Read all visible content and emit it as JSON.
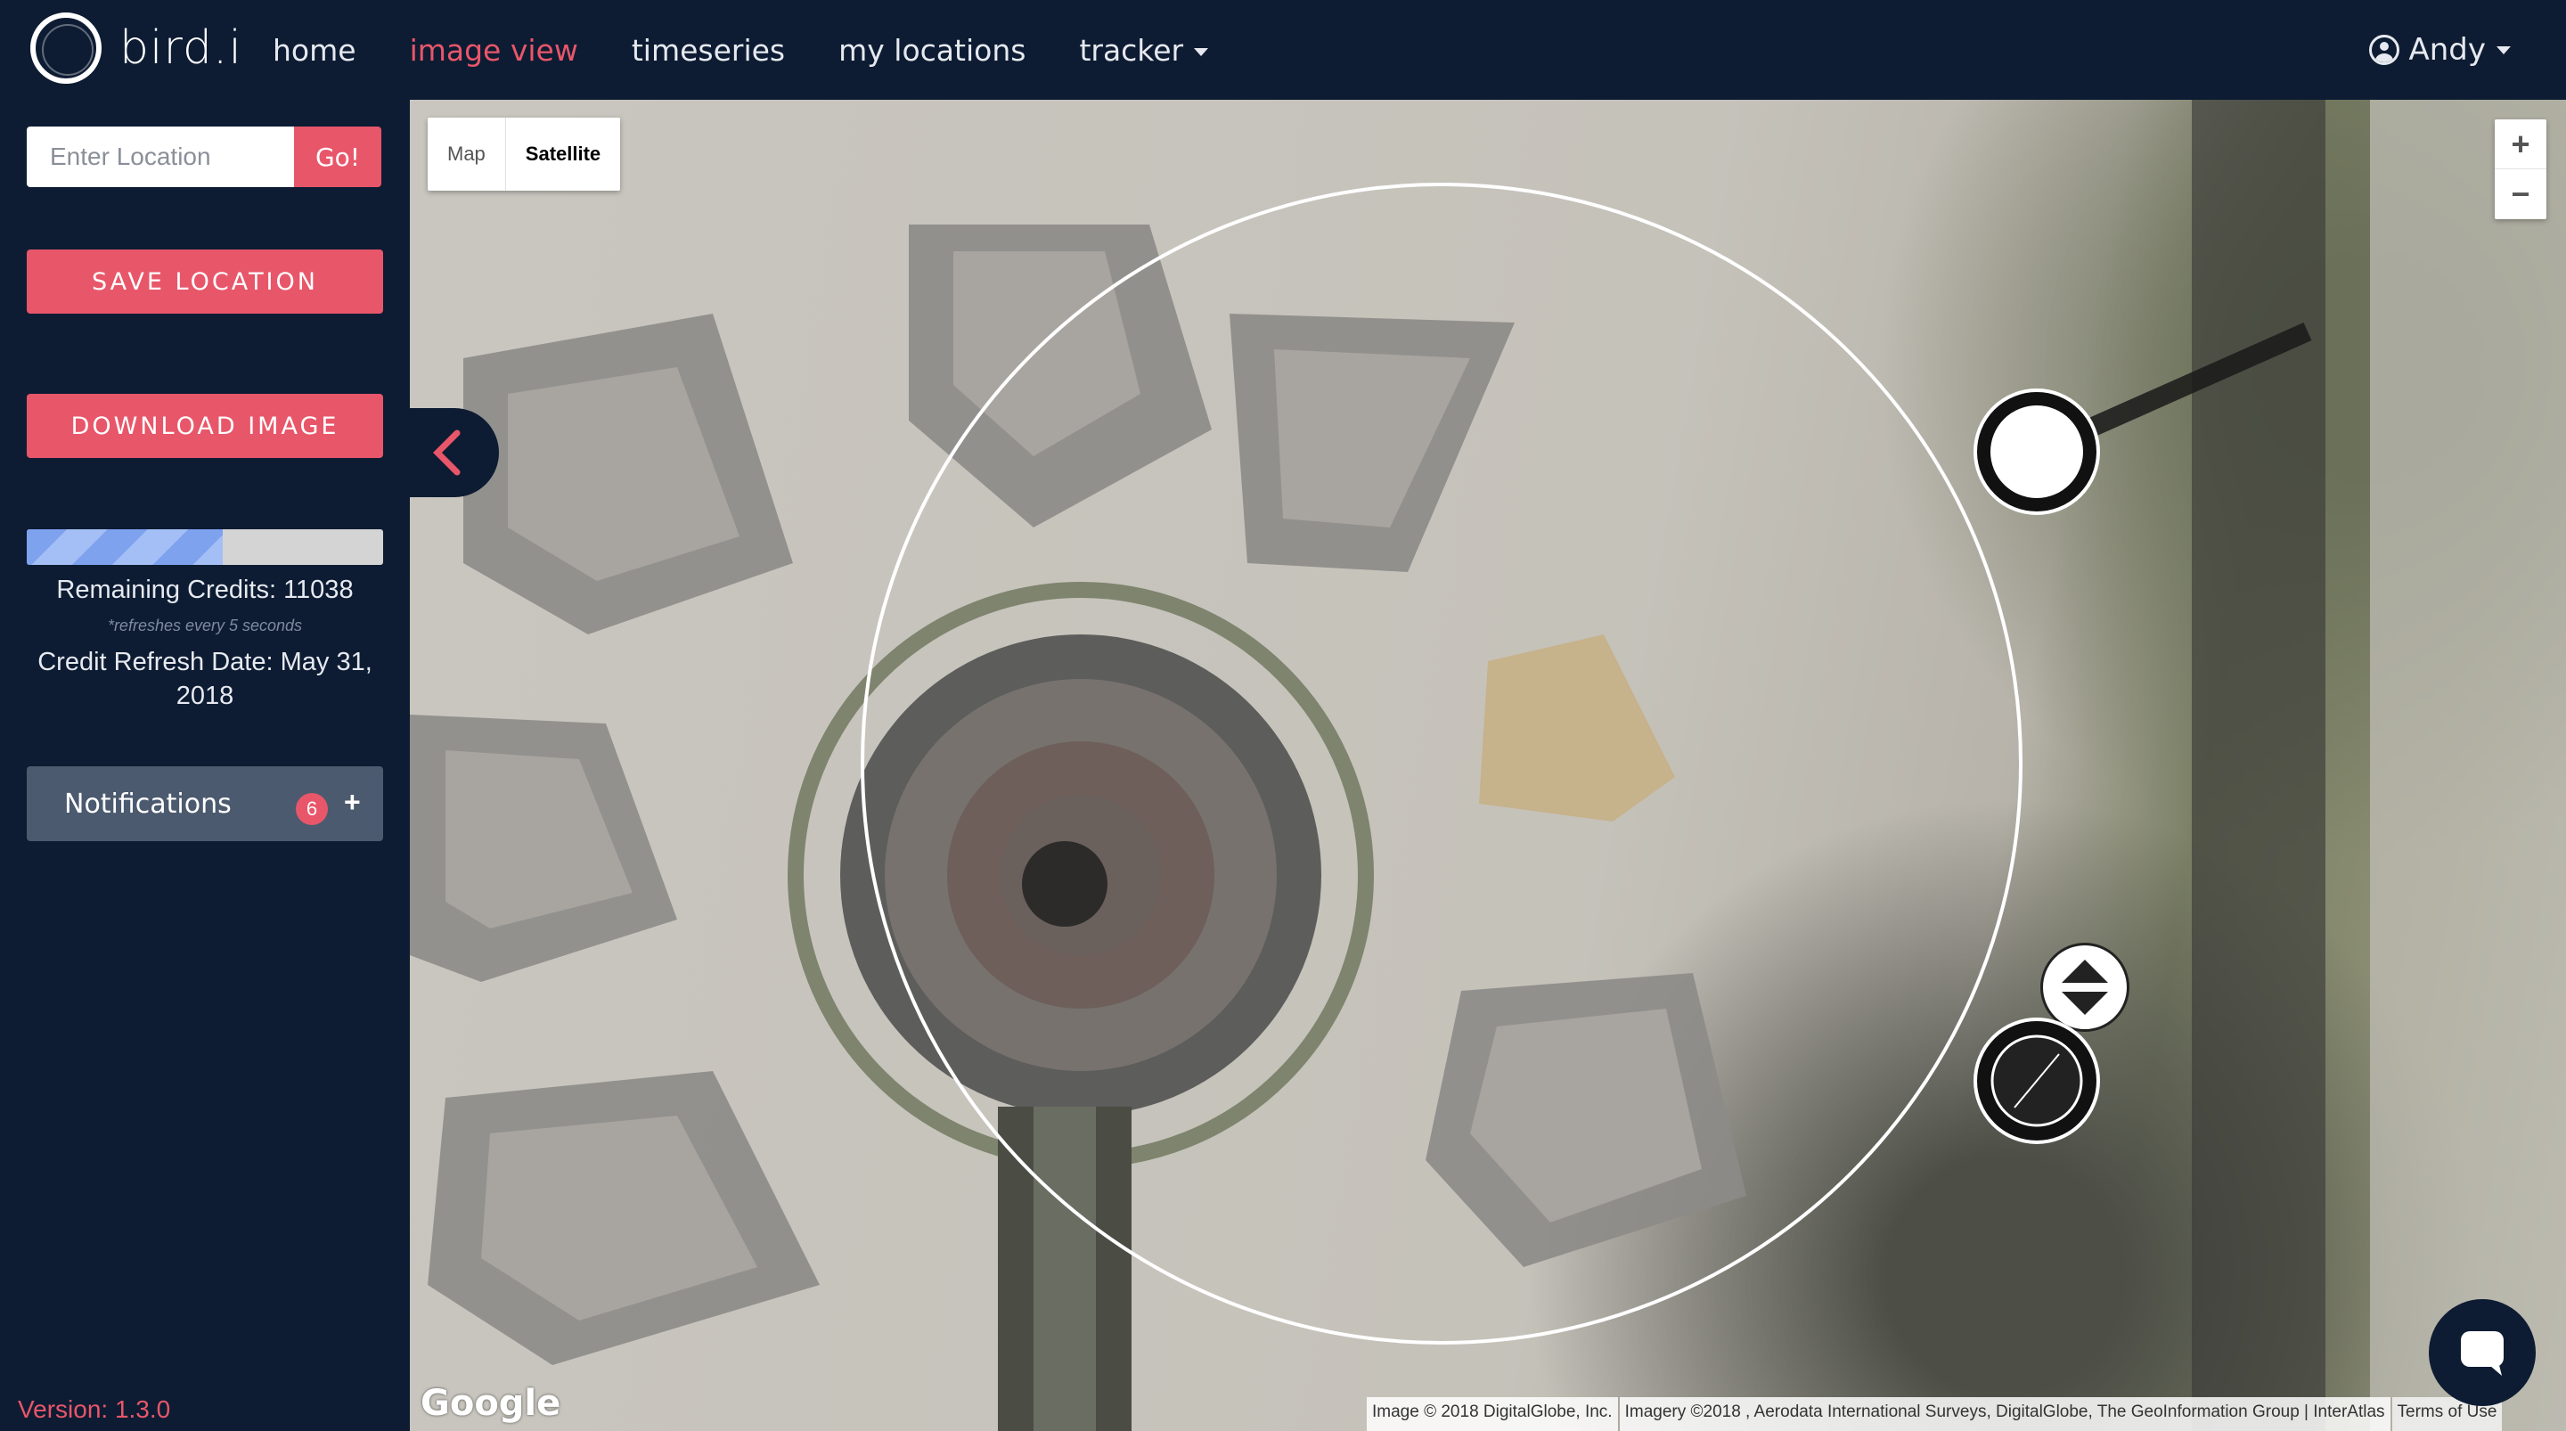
{
  "brand": {
    "name": "bird.i"
  },
  "nav": {
    "links": [
      {
        "label": "home"
      },
      {
        "label": "image view"
      },
      {
        "label": "timeseries"
      },
      {
        "label": "my locations"
      },
      {
        "label": "tracker"
      }
    ],
    "user": "Andy"
  },
  "sidebar": {
    "location_placeholder": "Enter Location",
    "go_label": "Go!",
    "save_label": "SAVE LOCATION",
    "download_label": "DOWNLOAD IMAGE",
    "credits_progress": 0.55,
    "remaining_credits": "Remaining Credits: 11038",
    "refresh_note": "*refreshes every 5 seconds",
    "refresh_date": "Credit Refresh Date: May 31, 2018",
    "notifications_label": "Notifications",
    "notifications_count": "6",
    "notifications_plus": "+",
    "version": "Version: 1.3.0"
  },
  "map": {
    "type_map": "Map",
    "type_satellite": "Satellite",
    "selected_type": "Satellite",
    "zoom_in": "+",
    "zoom_out": "−",
    "google_logo": "Google",
    "attribution_image": "Image © 2018 DigitalGlobe, Inc.",
    "attribution_imagery": "Imagery ©2018 , Aerodata International Surveys, DigitalGlobe, The GeoInformation Group | InterAtlas",
    "terms": "Terms of Use"
  },
  "colors": {
    "navy": "#0d1c33",
    "accent": "#e8566a",
    "notification_bg": "#4b5a6e"
  }
}
